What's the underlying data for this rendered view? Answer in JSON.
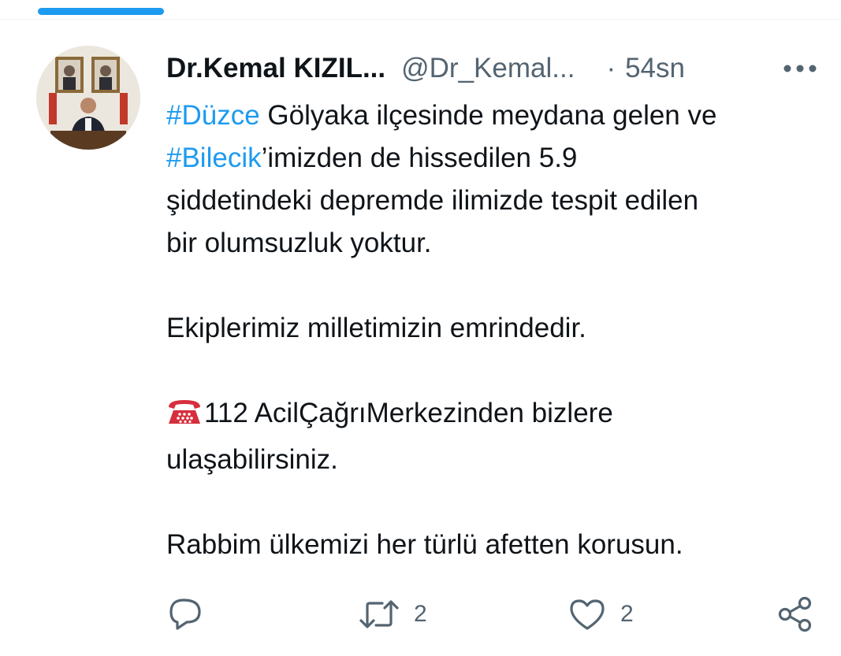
{
  "tweet": {
    "display_name": "Dr.Kemal KIZIL...",
    "handle": "@Dr_Kemal...",
    "separator": "·",
    "time": "54sn",
    "hashtags": {
      "duzce": "#Düzce",
      "bilecik": "#Bilecik"
    },
    "text": {
      "line1_rest": " Gölyaka ilçesinde meydana gelen ve",
      "line2_rest": "’imizden de hissedilen 5.9",
      "line3": "şiddetindeki depremde ilimizde tespit edilen",
      "line4": "bir olumsuzluk yoktur.",
      "para2": "Ekiplerimiz milletimizin emrindedir.",
      "para3_line1": "112 AcilÇağrıMerkezinden bizlere",
      "para3_line2": "ulaşabilirsiniz.",
      "para4": "Rabbim ülkemizi her türlü afetten korusun."
    }
  },
  "actions": {
    "reply_count": "",
    "retweet_count": "2",
    "like_count": "2"
  },
  "colors": {
    "accent": "#1d9bf0",
    "text": "#0f1419",
    "secondary": "#536471",
    "phone_emoji": "#d62e3d"
  },
  "icons": {
    "reply": "reply-icon",
    "retweet": "retweet-icon",
    "like": "heart-icon",
    "share": "share-icon",
    "more": "more-icon",
    "phone": "telephone-icon"
  }
}
